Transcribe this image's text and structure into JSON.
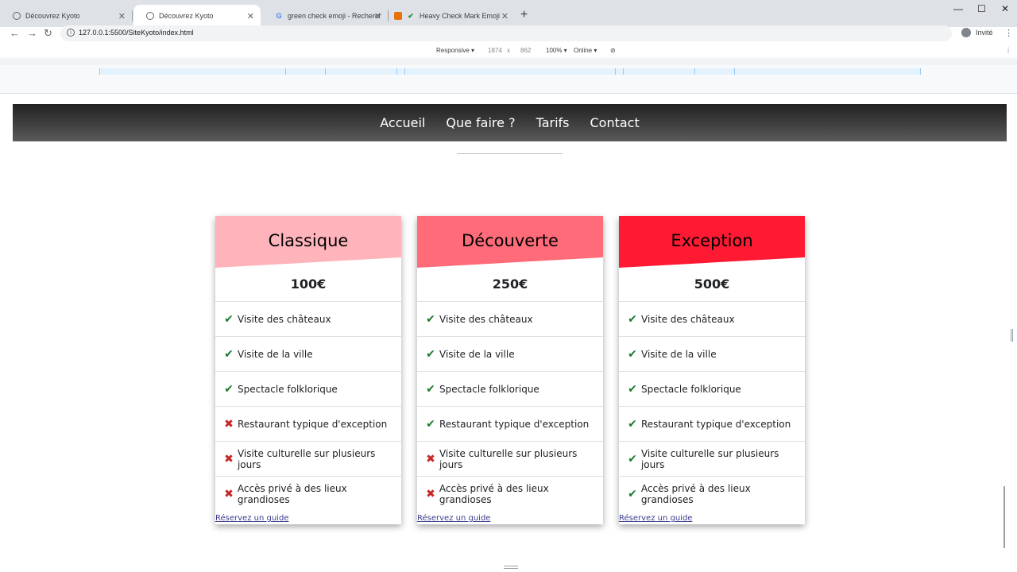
{
  "tabs": [
    {
      "title": "Découvrez Kyoto",
      "icon": "globe-icon"
    },
    {
      "title": "Découvrez Kyoto",
      "icon": "globe-icon"
    },
    {
      "title": "green check emoji - Recherche G",
      "icon": "google-icon"
    },
    {
      "title": "Heavy Check Mark Emoji",
      "icon": "check-icon"
    }
  ],
  "toolbar": {
    "url": "127.0.0.1:5500/SiteKyoto/index.html",
    "profile": "Invité"
  },
  "devtools": {
    "device": "Responsive ▾",
    "width": "1874",
    "times": "x",
    "height": "862",
    "zoom": "100% ▾",
    "network": "Online ▾"
  },
  "nav": {
    "items": [
      "Accueil",
      "Que faire ?",
      "Tarifs",
      "Contact"
    ]
  },
  "colors": {
    "classique": "#ffb3ba",
    "decouverte": "#ff6b78",
    "exception": "#ff1a33"
  },
  "plans": [
    {
      "title": "Classique",
      "price": "100€",
      "features": [
        {
          "text": "Visite des châteaux",
          "included": true
        },
        {
          "text": "Visite de la ville",
          "included": true
        },
        {
          "text": "Spectacle folklorique",
          "included": true
        },
        {
          "text": "Restaurant typique d'exception",
          "included": false
        },
        {
          "text": "Visite culturelle sur plusieurs jours",
          "included": false
        },
        {
          "text": "Accès privé à des lieux grandioses",
          "included": false
        }
      ],
      "link": "Réservez un guide"
    },
    {
      "title": "Découverte",
      "price": "250€",
      "features": [
        {
          "text": "Visite des châteaux",
          "included": true
        },
        {
          "text": "Visite de la ville",
          "included": true
        },
        {
          "text": "Spectacle folklorique",
          "included": true
        },
        {
          "text": "Restaurant typique d'exception",
          "included": true
        },
        {
          "text": "Visite culturelle sur plusieurs jours",
          "included": false
        },
        {
          "text": "Accès privé à des lieux grandioses",
          "included": false
        }
      ],
      "link": "Réservez un guide"
    },
    {
      "title": "Exception",
      "price": "500€",
      "features": [
        {
          "text": "Visite des châteaux",
          "included": true
        },
        {
          "text": "Visite de la ville",
          "included": true
        },
        {
          "text": "Spectacle folklorique",
          "included": true
        },
        {
          "text": "Restaurant typique d'exception",
          "included": true
        },
        {
          "text": "Visite culturelle sur plusieurs jours",
          "included": true
        },
        {
          "text": "Accès privé à des lieux grandioses",
          "included": true
        }
      ],
      "link": "Réservez un guide"
    }
  ]
}
